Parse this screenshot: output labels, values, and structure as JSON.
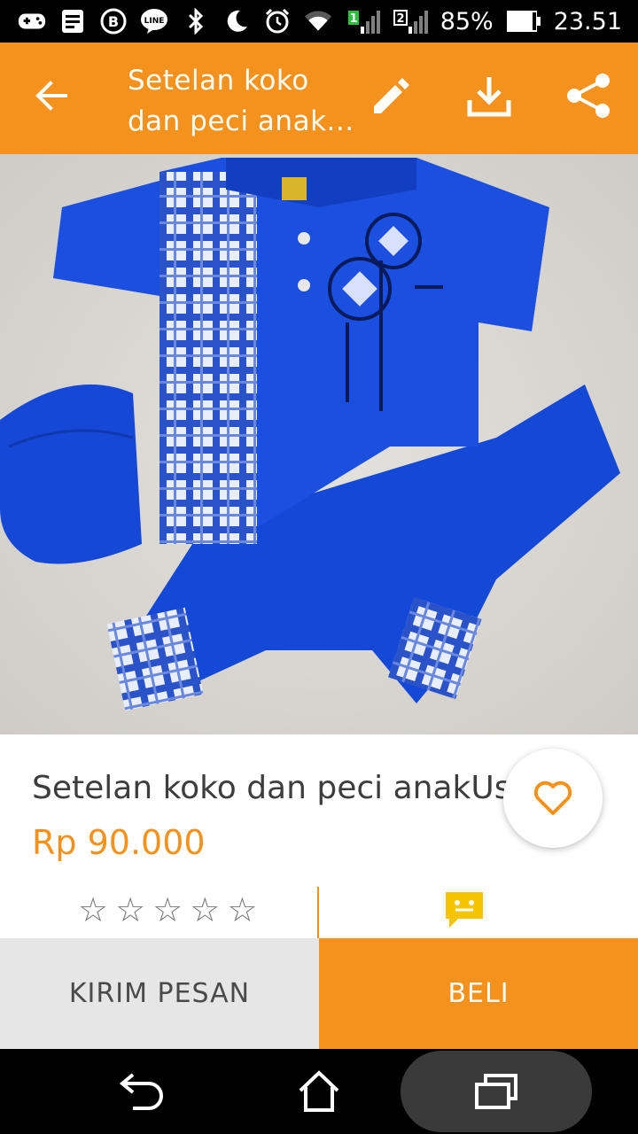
{
  "status_bar": {
    "icons": [
      "game-controller-icon",
      "notes-icon",
      "bbm-icon",
      "line-icon",
      "bluetooth-icon",
      "moon-icon",
      "alarm-icon",
      "wifi-icon",
      "signal-1-icon",
      "signal-2-icon"
    ],
    "sim1": "1",
    "sim2": "2",
    "battery": "85%",
    "time": "23.51"
  },
  "app_bar": {
    "title": "Setelan koko dan peci anak...",
    "icons": [
      "back-arrow-icon",
      "edit-icon",
      "download-icon",
      "share-icon"
    ]
  },
  "product": {
    "image_subject": "blue kids koko shirt with plaid panel, cap and trousers",
    "name": "Setelan koko dan peci anakUsia",
    "price": "Rp 90.000",
    "rating": 0,
    "rating_max": 5
  },
  "actions": {
    "message_label": "KIRIM PESAN",
    "buy_label": "BELI"
  },
  "colors": {
    "accent": "#f5921e",
    "status_bar": "#000000",
    "message_button_bg": "#e6e6e6"
  },
  "nav_bar": {
    "icons": [
      "back-icon",
      "home-icon",
      "recents-icon"
    ]
  }
}
